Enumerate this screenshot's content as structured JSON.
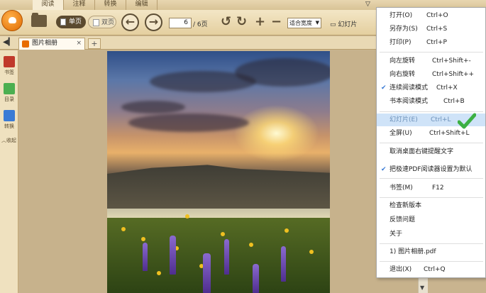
{
  "top_tabs": [
    "阅读",
    "注释",
    "转换",
    "编辑"
  ],
  "toolbar": {
    "single_page": "单页",
    "double_page": "双页",
    "page_current": "6",
    "page_total": "/ 6页",
    "zoom_value": "适合宽度",
    "slideshow": "幻灯片",
    "prev_icon": "arrow-left-icon",
    "next_icon": "arrow-right-icon"
  },
  "tabs": {
    "doc_name": "图片相册",
    "close": "×",
    "add": "+"
  },
  "sidebar": {
    "items": [
      {
        "label": "书签",
        "color": "#c0392b"
      },
      {
        "label": "目录",
        "color": "#4caf50"
      },
      {
        "label": "转换",
        "color": "#3a7bd5"
      }
    ],
    "collapse": "︿收起"
  },
  "menu": {
    "items": [
      {
        "label": "打开(O)",
        "shortcut": "Ctrl+O",
        "checked": false,
        "highlight": false
      },
      {
        "label": "另存为(S)",
        "shortcut": "Ctrl+S",
        "checked": false,
        "highlight": false
      },
      {
        "label": "打印(P)",
        "shortcut": "Ctrl+P",
        "checked": false,
        "highlight": false
      },
      {
        "label": "向左旋转",
        "shortcut": "Ctrl+Shift+-",
        "checked": false,
        "highlight": false
      },
      {
        "label": "向右旋转",
        "shortcut": "Ctrl+Shift++",
        "checked": false,
        "highlight": false
      },
      {
        "label": "连续阅读模式",
        "shortcut": "Ctrl+X",
        "checked": true,
        "highlight": false
      },
      {
        "label": "书本阅读模式",
        "shortcut": "Ctrl+B",
        "checked": false,
        "highlight": false
      },
      {
        "label": "幻灯片(E)",
        "shortcut": "Ctrl+L",
        "checked": false,
        "highlight": true
      },
      {
        "label": "全屏(U)",
        "shortcut": "Ctrl+Shift+L",
        "checked": false,
        "highlight": false
      },
      {
        "label": "取消桌面右键提醒文字",
        "shortcut": "",
        "checked": false,
        "highlight": false
      },
      {
        "label": "把极速PDF阅读器设置为默认",
        "shortcut": "",
        "checked": true,
        "highlight": false
      },
      {
        "label": "书签(M)",
        "shortcut": "F12",
        "checked": false,
        "highlight": false
      },
      {
        "label": "检查新版本",
        "shortcut": "",
        "checked": false,
        "highlight": false
      },
      {
        "label": "反馈问题",
        "shortcut": "",
        "checked": false,
        "highlight": false
      },
      {
        "label": "关于",
        "shortcut": "",
        "checked": false,
        "highlight": false
      },
      {
        "label": "1) 图片相册.pdf",
        "shortcut": "",
        "checked": false,
        "highlight": false
      },
      {
        "label": "退出(X)",
        "shortcut": "Ctrl+Q",
        "checked": false,
        "highlight": false
      }
    ]
  },
  "colors": {
    "accent": "#e86c00",
    "menu_highlight": "#cfe3f8",
    "check": "#3cb043"
  }
}
